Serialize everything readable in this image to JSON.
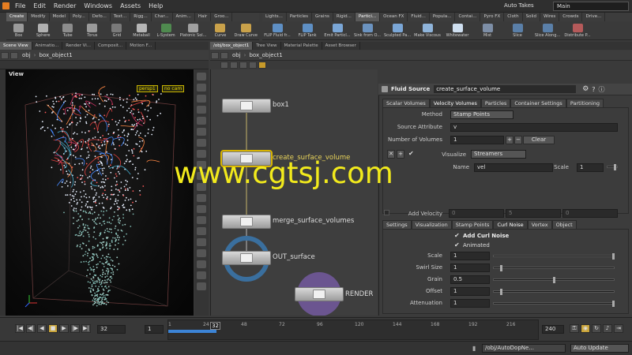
{
  "menu": [
    "File",
    "Edit",
    "Render",
    "Windows",
    "Assets",
    "Help"
  ],
  "auto_takes": "Auto Takes",
  "desktop": "Main",
  "shelf_tabs_left": [
    "Create",
    "Modify",
    "Model",
    "Poly...",
    "Defo...",
    "Text...",
    "Rigg...",
    "Char...",
    "Anim...",
    "Hair",
    "Groo..."
  ],
  "shelf_tabs_right": [
    "Lights...",
    "Particles",
    "Grains",
    "Rigid...",
    "Partici...",
    "Ocean FX",
    "Fluid...",
    "Popula...",
    "Contai...",
    "Pyro FX",
    "Cloth",
    "Solid",
    "Wires",
    "Crowds",
    "Drive..."
  ],
  "shelf_tools_left": [
    {
      "label": "Box",
      "color": "#9a9a9a"
    },
    {
      "label": "Sphere",
      "color": "#b0b0b0"
    },
    {
      "label": "Tube",
      "color": "#8c8c8c"
    },
    {
      "label": "Torus",
      "color": "#9a9a9a"
    },
    {
      "label": "Grid",
      "color": "#7a7a7a"
    },
    {
      "label": "Metaball",
      "color": "#b5b5b5"
    },
    {
      "label": "L-System",
      "color": "#4f8a4f"
    },
    {
      "label": "Platonic Sol...",
      "color": "#a0a0a0"
    },
    {
      "label": "Curve",
      "color": "#c9a14a"
    },
    {
      "label": "Draw Curve",
      "color": "#c9a14a"
    }
  ],
  "shelf_tools_right": [
    {
      "label": "FLIP Fluid fr...",
      "color": "#5e8fc4"
    },
    {
      "label": "FLIP Tank",
      "color": "#5e8fc4"
    },
    {
      "label": "Emit Particl...",
      "color": "#7aa6d6"
    },
    {
      "label": "Sink from O...",
      "color": "#6b93c0"
    },
    {
      "label": "Sculpted Pa...",
      "color": "#7aa6d6"
    },
    {
      "label": "Make Viscous",
      "color": "#8fb4da"
    },
    {
      "label": "Whitewater",
      "color": "#cfdff0"
    },
    {
      "label": "Mist",
      "color": "#7d8ea6"
    },
    {
      "label": "Slice",
      "color": "#5a7fa8"
    },
    {
      "label": "Slice Along...",
      "color": "#5a7fa8"
    },
    {
      "label": "Distribute P...",
      "color": "#b55a5a"
    }
  ],
  "left_pane_tabs": [
    "Scene View",
    "Animatio...",
    "Render Vi...",
    "Composit...",
    "Motion F..."
  ],
  "right_pane_tabs": [
    "/obj/box_object1",
    "Tree View",
    "Material Palette",
    "Asset Browser"
  ],
  "left_path": {
    "root": "obj",
    "node": "box_object1"
  },
  "right_path": {
    "root": "obj",
    "node": "box_object1"
  },
  "viewport": {
    "label": "View",
    "camera": "persp1",
    "cam2": "no cam"
  },
  "nodes": [
    {
      "label": "box1",
      "selected": false
    },
    {
      "label": "create_surface_volume",
      "selected": true
    },
    {
      "label": "merge_surface_volumes",
      "selected": false
    },
    {
      "label": "OUT_surface",
      "selected": false
    },
    {
      "label": "RENDER",
      "selected": false
    }
  ],
  "params": {
    "type": "Fluid Source",
    "name": "create_surface_volume",
    "tabs": [
      "Scalar Volumes",
      "Velocity Volumes",
      "Particles",
      "Container Settings",
      "Partitioning"
    ],
    "method_label": "Method",
    "method_value": "Stamp Points",
    "source_attr_label": "Source Attribute",
    "source_attr_value": "v",
    "num_volumes_label": "Number of Volumes",
    "num_volumes_value": "1",
    "clear_label": "Clear",
    "visualize_label": "Visualize",
    "visualize_value": "Streamers",
    "name_label": "Name",
    "name_value": "vel",
    "scale_label": "Scale",
    "scale_value": "1",
    "add_velocity": "Add Velocity",
    "add_velocity_vals": [
      "0",
      "5",
      "0"
    ],
    "subtabs": [
      "Settings",
      "Visualization",
      "Stamp Points",
      "Curl Noise",
      "Vortex",
      "Object"
    ],
    "add_curl_noise": "Add Curl Noise",
    "animated": "Animated",
    "curl_params": [
      {
        "label": "Scale",
        "value": "1",
        "fill": 1.0
      },
      {
        "label": "Swirl Size",
        "value": "1",
        "fill": 0.05
      },
      {
        "label": "Grain",
        "value": "0.5",
        "fill": 0.5
      },
      {
        "label": "Offset",
        "value": "1",
        "fill": 0.05
      },
      {
        "label": "Attenuation",
        "value": "1",
        "fill": 1.0
      }
    ]
  },
  "timeline": {
    "frame": "32",
    "start": "1",
    "end": "240",
    "step": "1",
    "ticks": [
      "1",
      "24",
      "48",
      "72",
      "96",
      "120",
      "144",
      "168",
      "192",
      "216"
    ],
    "current": "32",
    "progress": 0.13
  },
  "status": {
    "path": "/obj/AutoDopNe...",
    "update": "Auto Update"
  },
  "watermark": "www.cgtsj.com"
}
